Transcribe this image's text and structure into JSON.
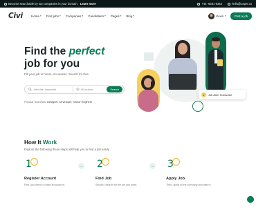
{
  "topbar": {
    "announcement": "Become searchable by top companies in your domain.",
    "learn_more": "Learn more",
    "phone": "+44 -6581-6352",
    "email": "hello@uxper.co"
  },
  "header": {
    "logo": "Civi",
    "nav": [
      "Home",
      "Find jobs",
      "Companies",
      "Candidates",
      "Pages",
      "Blog"
    ],
    "user_name": "Kevin",
    "post_job": "Post a job"
  },
  "hero": {
    "title_line1_a": "Find the ",
    "title_line1_b": "perfect",
    "title_line2": "job for you",
    "subtitle": "Fill your job in hours, not weeks. Search for free.",
    "search": {
      "keywords_placeholder": "Jobs title, keywords",
      "location_placeholder": "All location",
      "button": "Search"
    },
    "popular_label": "Popular Searches:",
    "popular_terms": "Designer, Developer, Senior Engineer",
    "alert_card": "Job Alert Subscribe"
  },
  "how_it_works": {
    "title_a": "How It ",
    "title_b": "Work",
    "subtitle": "Explore the following these steps will help you to find a job easily",
    "steps": [
      {
        "num": "1",
        "title": "Register Account",
        "desc": "First, you need to make an account."
      },
      {
        "num": "2",
        "title": "Find Job",
        "desc": "Second, search for the job you want."
      },
      {
        "num": "3",
        "title": "Apply Job",
        "desc": "Third, apply to the company and want it."
      }
    ]
  },
  "colors": {
    "brand": "#0b7a57",
    "accent": "#f4cf5e",
    "dark": "#0c1818"
  }
}
